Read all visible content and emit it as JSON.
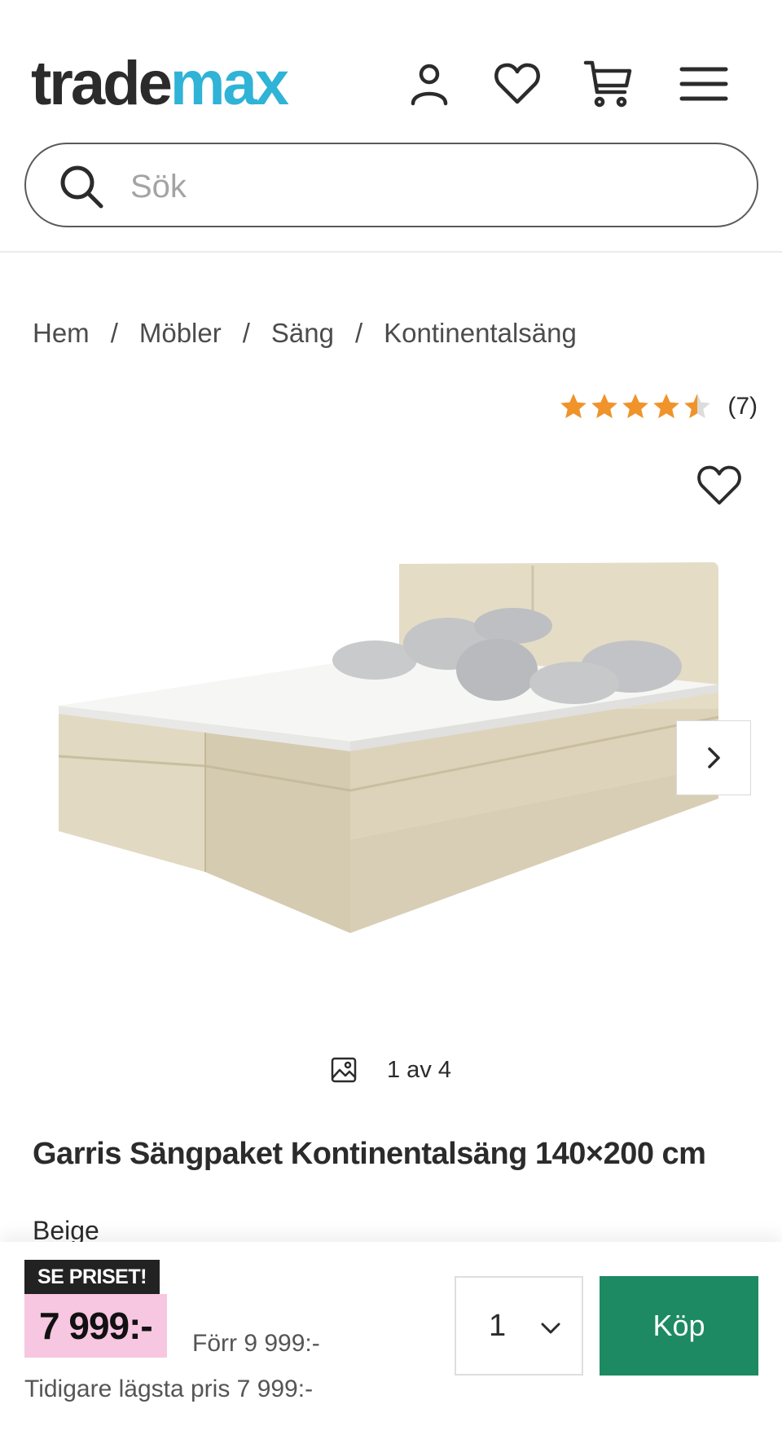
{
  "header": {
    "logo_part1": "trade",
    "logo_part2": "max",
    "brand_color": "#2fb3d6",
    "icons": [
      "user-icon",
      "heart-icon",
      "cart-icon",
      "menu-icon"
    ]
  },
  "search": {
    "placeholder": "Sök",
    "value": ""
  },
  "breadcrumb": {
    "items": [
      "Hem",
      "Möbler",
      "Säng",
      "Kontinentalsäng"
    ],
    "separator": "/"
  },
  "rating": {
    "stars": 4.5,
    "max": 5,
    "count": "(7)",
    "star_color": "#f0932b"
  },
  "gallery": {
    "counter": "1 av 4",
    "current": 1,
    "total": 4
  },
  "product": {
    "title": "Garris Sängpaket Kontinentalsäng 140×200 cm",
    "color": "Beige"
  },
  "purchase": {
    "badge": "SE PRISET!",
    "price": "7 999:-",
    "old_price": "Förr 9 999:-",
    "lowest_price": "Tidigare lägsta pris 7 999:-",
    "quantity": "1",
    "buy_label": "Köp",
    "buy_color": "#1d8a63",
    "price_bg": "#f7c6e0"
  }
}
